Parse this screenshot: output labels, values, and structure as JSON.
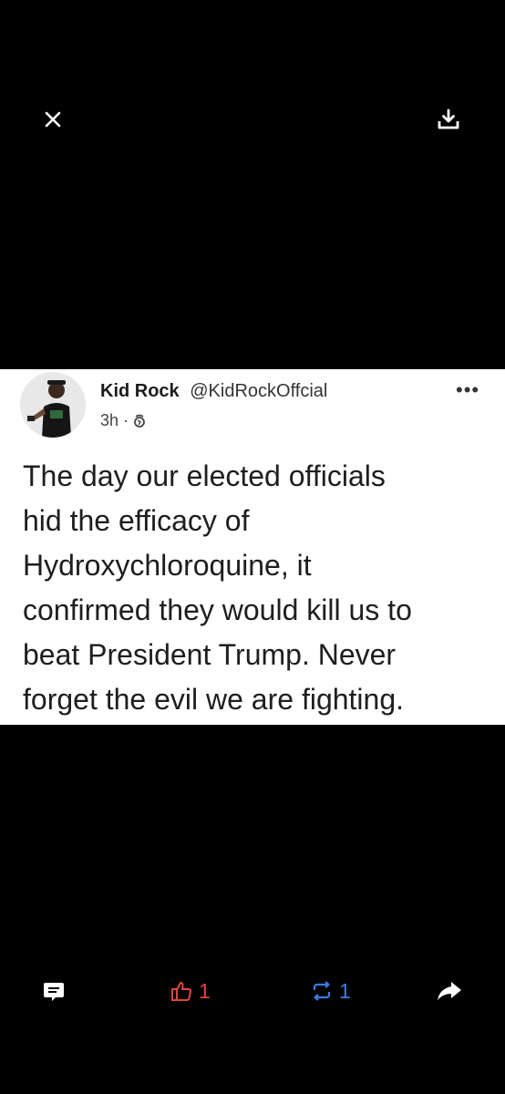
{
  "toolbar": {
    "close_icon": "close-icon",
    "download_icon": "download-icon"
  },
  "post": {
    "author_name": "Kid Rock",
    "author_handle": "@KidRockOffcial",
    "time": "3h",
    "separator": "·",
    "visibility_icon": "globe-icon",
    "more_icon": "more-dots-icon",
    "more_label": "•••",
    "text": "The day our elected officials\nhid the efficacy of\nHydroxychloroquine, it\nconfirmed they would kill us to\nbeat President Trump. Never\nforget the evil we are fighting."
  },
  "actions": {
    "comment_icon": "comment-icon",
    "like_icon": "thumbs-up-icon",
    "like_count": "1",
    "repost_icon": "repost-icon",
    "repost_count": "1",
    "share_icon": "share-arrow-icon"
  },
  "colors": {
    "background": "#000000",
    "card": "#ffffff",
    "like": "#e0463a",
    "repost": "#3a7be0"
  }
}
